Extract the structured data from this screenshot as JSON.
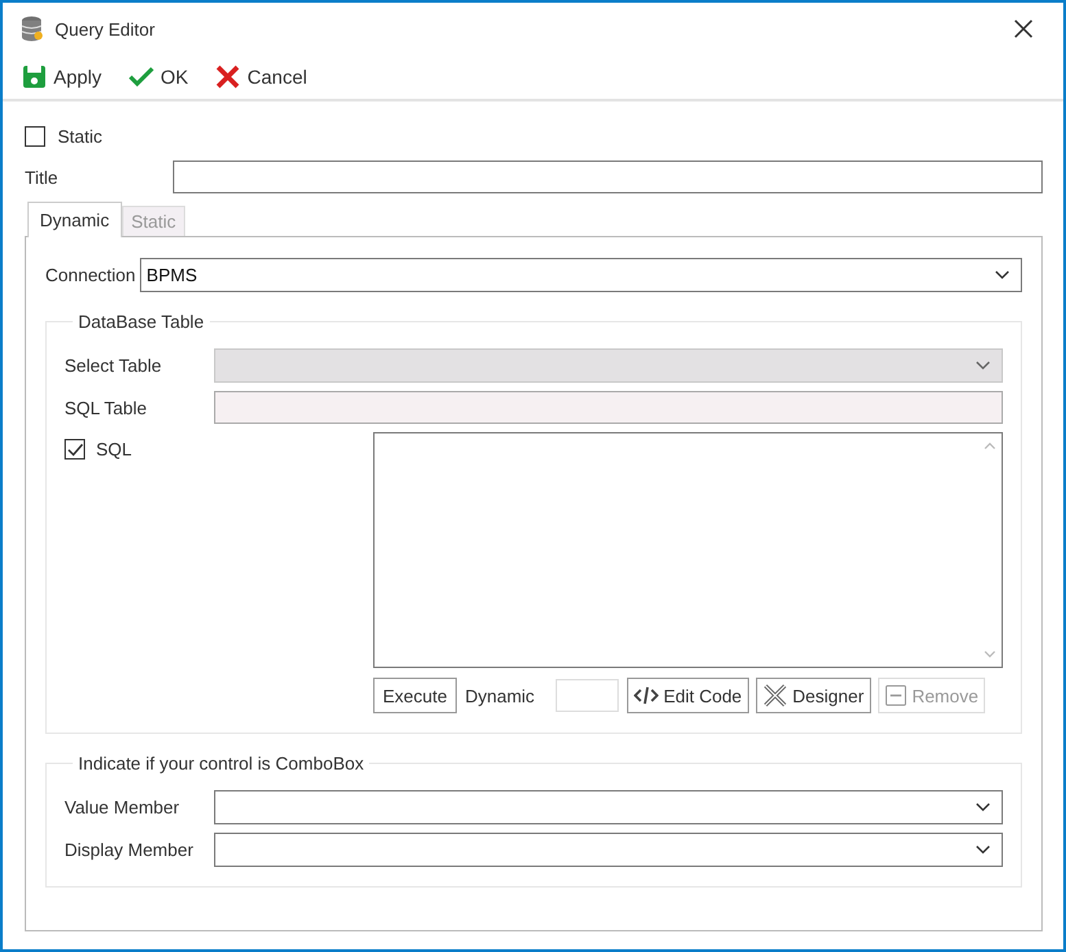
{
  "window": {
    "title": "Query Editor"
  },
  "toolbar": [
    {
      "kind": "save",
      "label": "Apply"
    },
    {
      "kind": "ok",
      "label": "OK"
    },
    {
      "kind": "cancel",
      "label": "Cancel"
    }
  ],
  "static_checkbox": {
    "label": "Static",
    "checked": false
  },
  "title_field": {
    "label": "Title"
  },
  "tabs": [
    {
      "label": "Dynamic",
      "selected": true
    },
    {
      "label": "Static",
      "selected": false
    }
  ],
  "connection": {
    "label": "Connection",
    "value": "BPMS"
  },
  "database_group": {
    "title": "DataBase Table",
    "select_table": {
      "label": "Select Table",
      "disabled": true
    },
    "sql_table": {
      "label": "SQL Table",
      "disabled": true
    },
    "sql_checkbox": {
      "label": "SQL",
      "checked": true
    },
    "execute_button": {
      "label": "Execute"
    },
    "dynamic_field": {
      "label": "Dynamic"
    },
    "tool_buttons": [
      {
        "kind": "code",
        "label": "Edit Code",
        "disabled": false
      },
      {
        "kind": "designer",
        "label": "Designer",
        "disabled": false
      },
      {
        "kind": "remove",
        "label": "Remove",
        "disabled": true
      }
    ]
  },
  "combobox_group": {
    "title": "Indicate if your control is ComboBox",
    "fields": [
      {
        "label": "Value Member"
      },
      {
        "label": "Display Member"
      }
    ]
  }
}
